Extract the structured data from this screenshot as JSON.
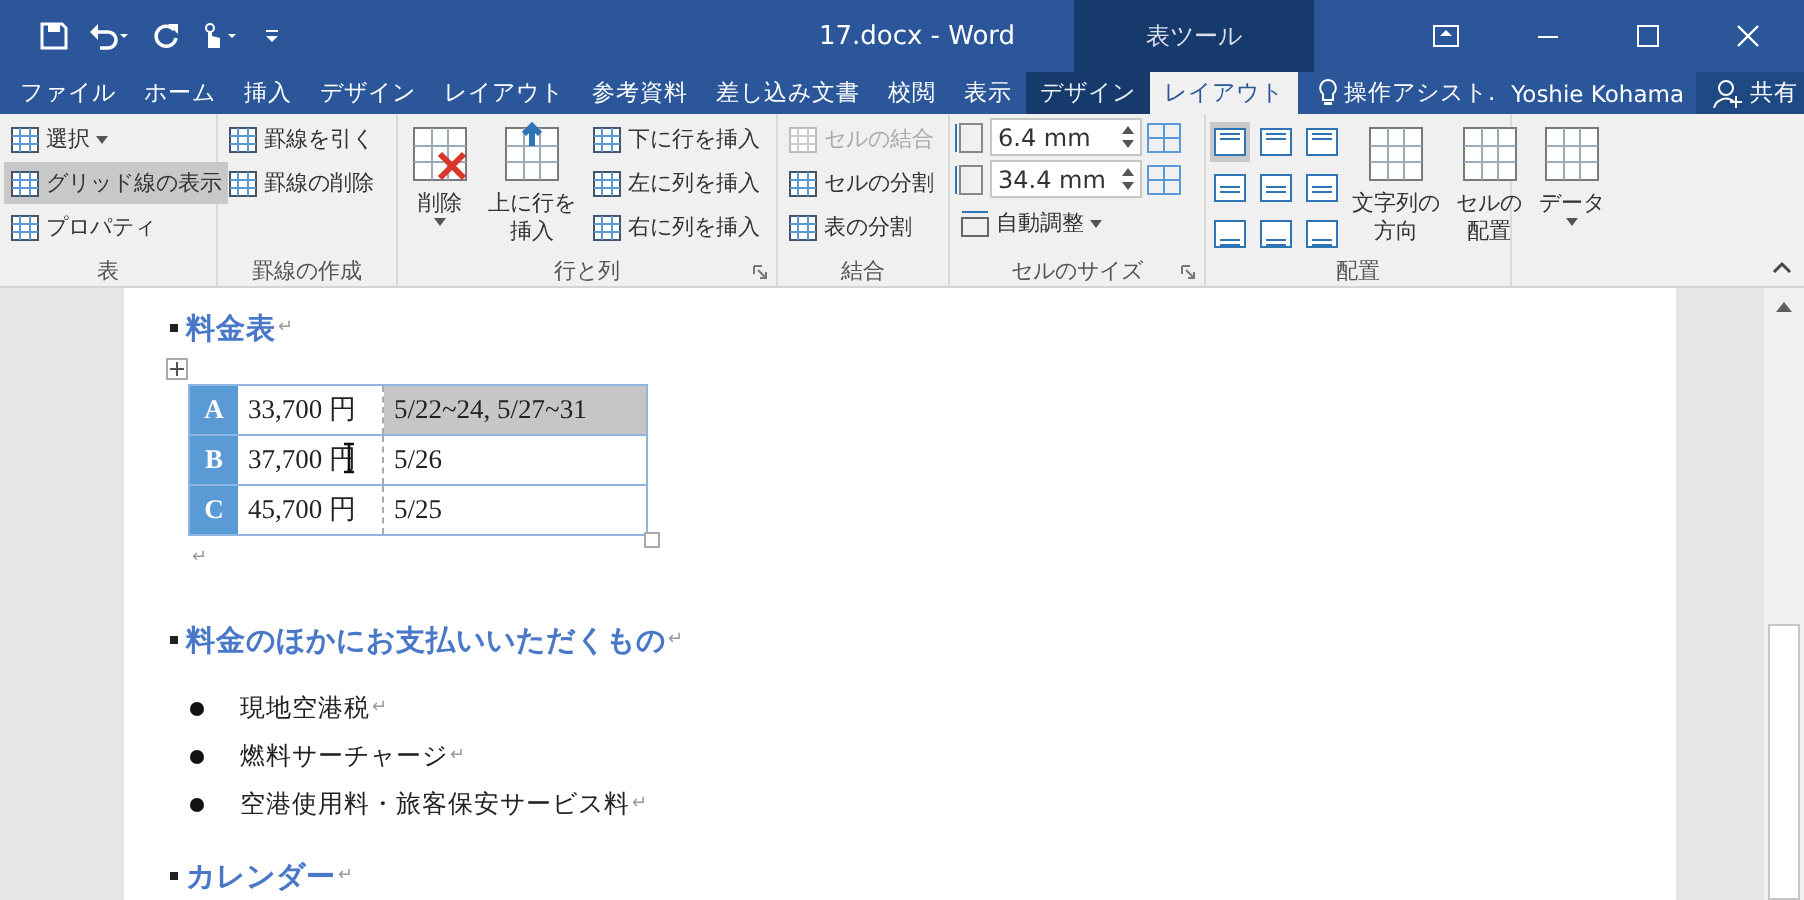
{
  "window": {
    "title": "17.docx - Word",
    "context_tab_group": "表ツール"
  },
  "tabs": [
    {
      "label": "ファイル",
      "selected": false,
      "contextual": false
    },
    {
      "label": "ホーム",
      "selected": false,
      "contextual": false
    },
    {
      "label": "挿入",
      "selected": false,
      "contextual": false
    },
    {
      "label": "デザイン",
      "selected": false,
      "contextual": false
    },
    {
      "label": "レイアウト",
      "selected": false,
      "contextual": false
    },
    {
      "label": "参考資料",
      "selected": false,
      "contextual": false
    },
    {
      "label": "差し込み文書",
      "selected": false,
      "contextual": false
    },
    {
      "label": "校閲",
      "selected": false,
      "contextual": false
    },
    {
      "label": "表示",
      "selected": false,
      "contextual": false
    },
    {
      "label": "デザイン",
      "selected": false,
      "contextual": true
    },
    {
      "label": "レイアウト",
      "selected": true,
      "contextual": true
    }
  ],
  "tell_me": "操作アシスト.",
  "user": "Yoshie Kohama",
  "share": "共有",
  "ribbon": [
    {
      "label": "表",
      "columns": [
        {
          "kind": "small",
          "items": [
            {
              "label": "選択",
              "dropdown": true,
              "selected": false,
              "disabled": false
            },
            {
              "label": "グリッド線の表示",
              "dropdown": false,
              "selected": true,
              "disabled": false
            },
            {
              "label": "プロパティ",
              "dropdown": false,
              "selected": false,
              "disabled": false
            }
          ]
        }
      ]
    },
    {
      "label": "罫線の作成",
      "columns": [
        {
          "kind": "small",
          "items": [
            {
              "label": "罫線を引く",
              "dropdown": false,
              "selected": false,
              "disabled": false
            },
            {
              "label": "罫線の削除",
              "dropdown": false,
              "selected": false,
              "disabled": false
            }
          ]
        }
      ]
    },
    {
      "label": "行と列",
      "launcher": true,
      "columns": [
        {
          "kind": "large",
          "lines": [
            "削除"
          ],
          "dropdown": true
        },
        {
          "kind": "large",
          "lines": [
            "上に行を",
            "挿入"
          ],
          "dropdown": false
        },
        {
          "kind": "small",
          "items": [
            {
              "label": "下に行を挿入",
              "dropdown": false,
              "selected": false,
              "disabled": false
            },
            {
              "label": "左に列を挿入",
              "dropdown": false,
              "selected": false,
              "disabled": false
            },
            {
              "label": "右に列を挿入",
              "dropdown": false,
              "selected": false,
              "disabled": false
            }
          ]
        }
      ]
    },
    {
      "label": "結合",
      "columns": [
        {
          "kind": "small",
          "items": [
            {
              "label": "セルの結合",
              "dropdown": false,
              "selected": false,
              "disabled": true
            },
            {
              "label": "セルの分割",
              "dropdown": false,
              "selected": false,
              "disabled": false
            },
            {
              "label": "表の分割",
              "dropdown": false,
              "selected": false,
              "disabled": false
            }
          ]
        }
      ]
    },
    {
      "label": "セルのサイズ",
      "launcher": true,
      "columns": [
        {
          "kind": "size",
          "spinners": [
            "6.4 mm",
            "34.4 mm"
          ],
          "autofit": "自動調整"
        }
      ]
    },
    {
      "label": "配置",
      "columns": [
        {
          "kind": "align",
          "cells": [
            {
              "selected": true
            },
            {
              "selected": false
            },
            {
              "selected": false
            },
            {
              "selected": false
            },
            {
              "selected": false
            },
            {
              "selected": false
            },
            {
              "selected": false
            },
            {
              "selected": false
            },
            {
              "selected": false
            }
          ]
        },
        {
          "kind": "large",
          "lines": [
            "文字列の",
            "方向"
          ],
          "dropdown": false
        },
        {
          "kind": "large",
          "lines": [
            "セルの",
            "配置"
          ],
          "dropdown": false
        }
      ]
    },
    {
      "columns": [
        {
          "kind": "large",
          "lines": [
            "データ"
          ],
          "dropdown": true
        }
      ]
    }
  ],
  "document": [
    {
      "kind": "heading",
      "text": "料金表",
      "mark": "↵"
    },
    {
      "kind": "table",
      "rows": [
        {
          "key": "A",
          "price": "33,700 円",
          "dates": "5/22~24, 5/27~31",
          "selected": true
        },
        {
          "key": "B",
          "price": "37,700 円",
          "dates": "5/26",
          "selected": false
        },
        {
          "key": "C",
          "price": "45,700 円",
          "dates": "5/25",
          "selected": false
        }
      ],
      "mark": "↵"
    },
    {
      "kind": "heading",
      "text": "料金のほかにお支払いいただくもの",
      "mark": "↵"
    },
    {
      "kind": "bullet",
      "text": "現地空港税",
      "mark": "↵"
    },
    {
      "kind": "bullet",
      "text": "燃料サーチャージ",
      "mark": "↵"
    },
    {
      "kind": "bullet",
      "text": "空港使用料・旅客保安サービス料",
      "mark": "↵"
    },
    {
      "kind": "heading",
      "text": "カレンダー",
      "mark": "↵"
    }
  ]
}
